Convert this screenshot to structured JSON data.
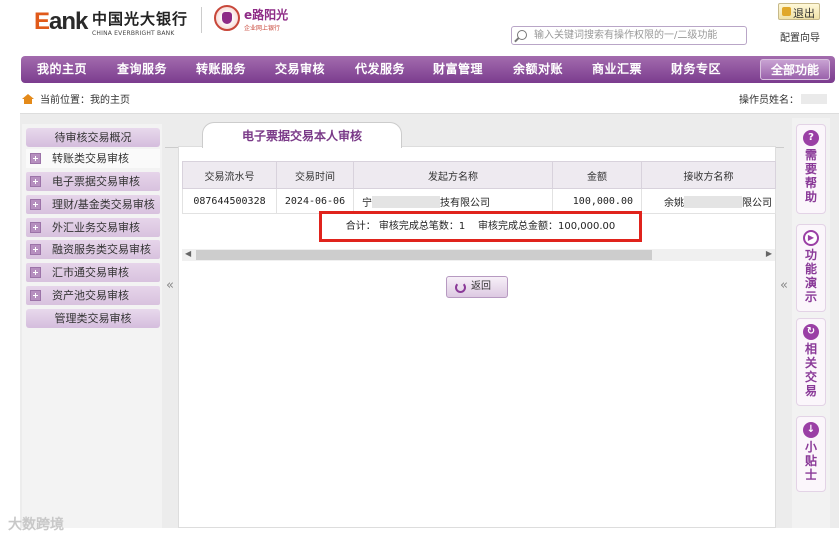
{
  "header": {
    "bank_logo_lead": "E",
    "bank_logo_rest": "ank",
    "bank_name_cn": "中国光大银行",
    "bank_name_en": "CHINA EVERBRIGHT BANK",
    "brand_title": "阳光",
    "brand_prefix": "e路",
    "brand_sub": "企业网上银行",
    "logout_label": "退出",
    "config_guide_label": "配置向导",
    "search_placeholder": "输入关键词搜索有操作权限的一/二级功能"
  },
  "nav": {
    "items": [
      "我的主页",
      "查询服务",
      "转账服务",
      "交易审核",
      "代发服务",
      "财富管理",
      "余额对账",
      "商业汇票",
      "财务专区"
    ],
    "all_functions": "全部功能"
  },
  "breadcrumb": {
    "label": "当前位置：",
    "current": "我的主页"
  },
  "operator_label": "操作员姓名：",
  "sidebar": {
    "header": "待审核交易概况",
    "items": [
      "转账类交易审核",
      "电子票据交易审核",
      "理财/基金类交易审核",
      "外汇业务交易审核",
      "融资服务类交易审核",
      "汇市通交易审核",
      "资产池交易审核"
    ],
    "footer": "管理类交易审核"
  },
  "panel": {
    "tab_title": "电子票据交易本人审核",
    "columns": [
      "交易流水号",
      "交易时间",
      "发起方名称",
      "金额",
      "接收方名称"
    ],
    "rows": [
      {
        "serial": "087644500328",
        "time": "2024-06-06",
        "initiator_prefix": "宁",
        "initiator_suffix": "技有限公司",
        "amount": "100,000.00",
        "receiver_prefix": "余姚",
        "receiver_suffix": "限公司"
      }
    ],
    "summary": {
      "label": "合计：",
      "count_label": "审核完成总笔数：",
      "count": "1",
      "amount_label": "审核完成总金额：",
      "amount": "100,000.00"
    },
    "back_label": "返回",
    "collapse_glyph": "«"
  },
  "right_panel": [
    {
      "text": "需要帮助",
      "icon": "question-icon",
      "glyph": "?"
    },
    {
      "text": "功能演示",
      "icon": "play-icon",
      "glyph": "▶"
    },
    {
      "text": "相关交易",
      "icon": "refresh-icon",
      "glyph": "↻"
    },
    {
      "text": "小贴士",
      "icon": "download-icon",
      "glyph": "↓"
    }
  ],
  "watermark": "大数跨境",
  "colors": {
    "brand_purple": "#8e2b86",
    "nav_purple": "#7b3c8e",
    "highlight_red": "#e0231c",
    "logo_red": "#cc1b1b"
  }
}
